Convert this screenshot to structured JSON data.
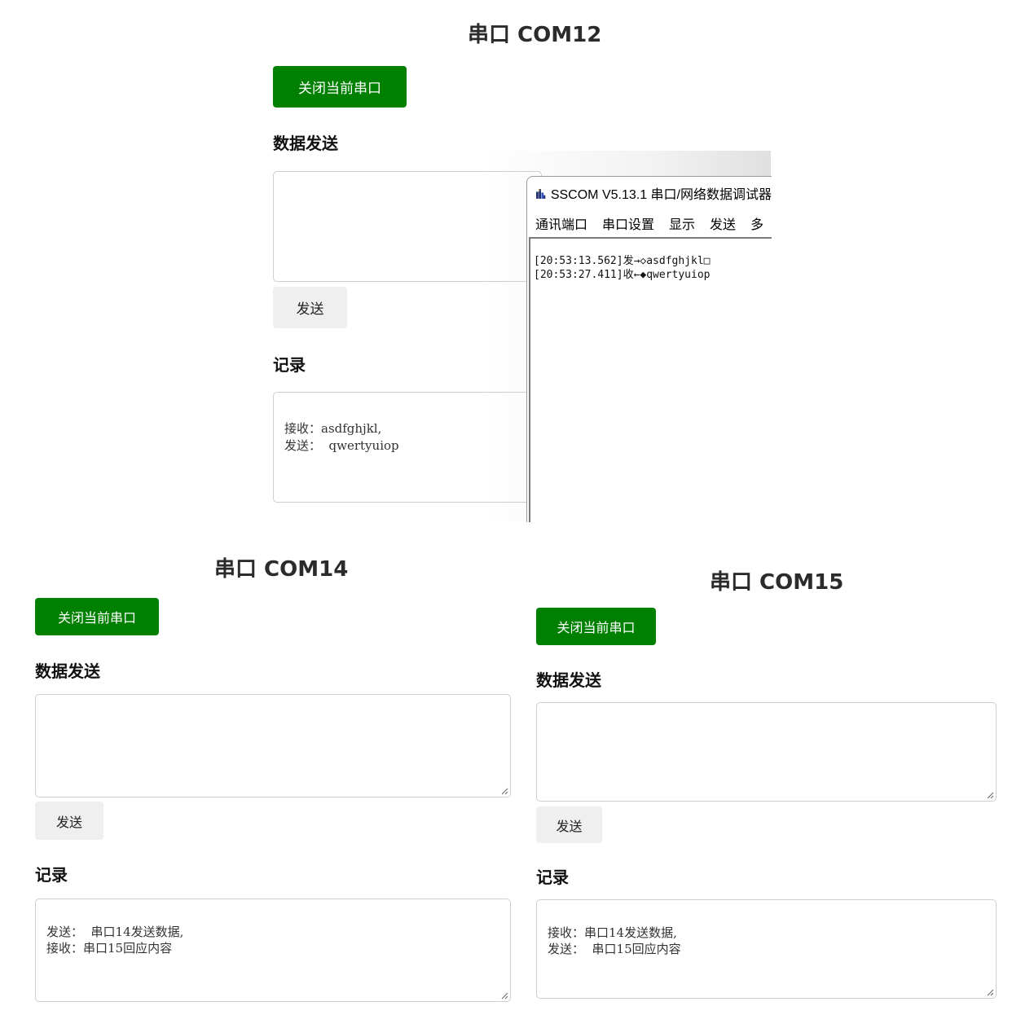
{
  "panels": {
    "com12": {
      "title": "串口 COM12",
      "close_label": "关闭当前串口",
      "send_heading": "数据发送",
      "send_value": "",
      "send_button": "发送",
      "log_heading": "记录",
      "log": [
        "接收：asdfghjkl,",
        "发送：  qwertyuiop"
      ]
    },
    "com14": {
      "title": "串口 COM14",
      "close_label": "关闭当前串口",
      "send_heading": "数据发送",
      "send_value": "",
      "send_button": "发送",
      "log_heading": "记录",
      "log": [
        "发送：  串口14发送数据,",
        "接收：串口15回应内容"
      ]
    },
    "com15": {
      "title": "串口 COM15",
      "close_label": "关闭当前串口",
      "send_heading": "数据发送",
      "send_value": "",
      "send_button": "发送",
      "log_heading": "记录",
      "log": [
        "接收：串口14发送数据,",
        "发送：  串口15回应内容"
      ]
    }
  },
  "sscom": {
    "title": "SSCOM V5.13.1 串口/网络数据调试器",
    "icon": "sscom-app-icon",
    "menu": [
      "通讯端口",
      "串口设置",
      "显示",
      "发送",
      "多"
    ],
    "output": [
      "[20:53:13.562]发→◇asdfghjkl□",
      "[20:53:27.411]收←◆qwertyuiop"
    ]
  },
  "colors": {
    "close_button_bg": "#008000",
    "send_button_bg": "#efefef"
  }
}
